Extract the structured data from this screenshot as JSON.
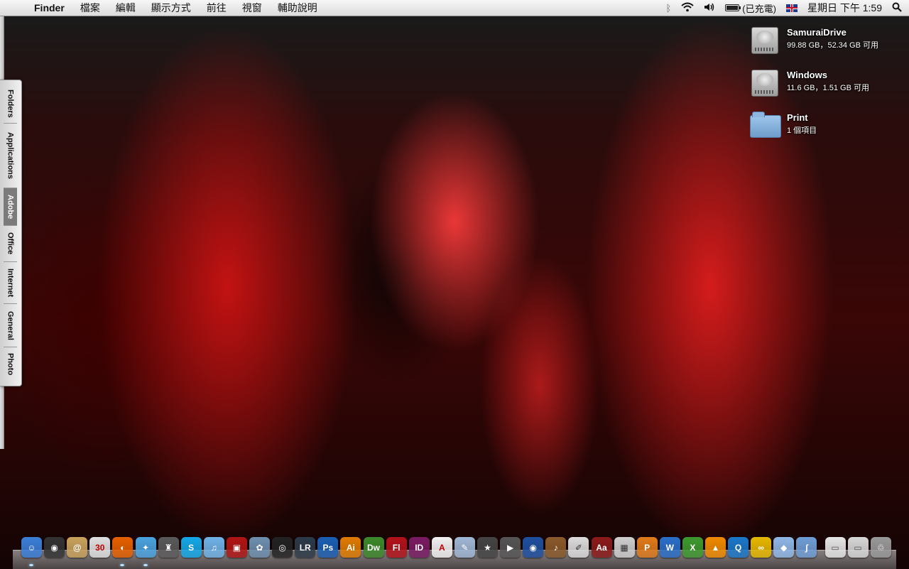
{
  "menubar": {
    "app_name": "Finder",
    "items": [
      "檔案",
      "編輯",
      "顯示方式",
      "前往",
      "視窗",
      "輔助說明"
    ],
    "battery_status": "(已充電)",
    "clock": "星期日 下午 1:59"
  },
  "drawer": {
    "tabs": [
      {
        "label": "Folders"
      },
      {
        "label": "Applications"
      },
      {
        "label": "Adobe"
      },
      {
        "label": "Office"
      },
      {
        "label": "Internet"
      },
      {
        "label": "General"
      },
      {
        "label": "Photo"
      }
    ],
    "active_tab": "Adobe"
  },
  "desktop": {
    "items": [
      {
        "name": "SamuraiDrive",
        "info": "99.88 GB，52.34 GB 可用",
        "icon": "hard-drive-icon"
      },
      {
        "name": "Windows",
        "info": "11.6 GB，1.51 GB 可用",
        "icon": "hard-drive-icon"
      },
      {
        "name": "Print",
        "info": "1 個項目",
        "icon": "folder-icon"
      }
    ]
  },
  "dock": {
    "apps": [
      {
        "name": "finder",
        "text": "☺",
        "color": "#3b7fd9"
      },
      {
        "name": "dashboard",
        "text": "◉",
        "color": "#333333"
      },
      {
        "name": "address-book",
        "text": "@",
        "color": "#c9a25c"
      },
      {
        "name": "ical",
        "text": "30",
        "color": "#e0e0e0",
        "fg": "#c00000"
      },
      {
        "name": "firefox",
        "text": "◐",
        "color": "#e66000"
      },
      {
        "name": "safari",
        "text": "✦",
        "color": "#4aa3df"
      },
      {
        "name": "script-app",
        "text": "♜",
        "color": "#5a5a5a"
      },
      {
        "name": "skype",
        "text": "S",
        "color": "#14a8e8"
      },
      {
        "name": "itunes",
        "text": "♫",
        "color": "#6fb3e8"
      },
      {
        "name": "photo-booth",
        "text": "▣",
        "color": "#b01515"
      },
      {
        "name": "iphoto",
        "text": "✿",
        "color": "#6d8fb0"
      },
      {
        "name": "aperture",
        "text": "◎",
        "color": "#222222"
      },
      {
        "name": "lightroom",
        "text": "LR",
        "color": "#2c3a4a"
      },
      {
        "name": "photoshop",
        "text": "Ps",
        "color": "#1a5fb4"
      },
      {
        "name": "illustrator",
        "text": "Ai",
        "color": "#e07b00"
      },
      {
        "name": "dreamweaver",
        "text": "Dw",
        "color": "#3c8a2a"
      },
      {
        "name": "flash",
        "text": "Fl",
        "color": "#b3121b"
      },
      {
        "name": "indesign",
        "text": "ID",
        "color": "#7a1b63"
      },
      {
        "name": "acrobat",
        "text": "A",
        "color": "#f2f2f2",
        "fg": "#c00000"
      },
      {
        "name": "preview",
        "text": "✎",
        "color": "#9fb8d6"
      },
      {
        "name": "imovie-star",
        "text": "★",
        "color": "#444444"
      },
      {
        "name": "imovie",
        "text": "▶",
        "color": "#555555"
      },
      {
        "name": "dvd-player",
        "text": "◉",
        "color": "#1e4fa0"
      },
      {
        "name": "garageband",
        "text": "♪",
        "color": "#8a5a2a"
      },
      {
        "name": "textedit",
        "text": "✐",
        "color": "#dcdcdc",
        "fg": "#333333"
      },
      {
        "name": "dictionary",
        "text": "Aa",
        "color": "#8b1a1a"
      },
      {
        "name": "calculator",
        "text": "▦",
        "color": "#cfcfcf",
        "fg": "#333333"
      },
      {
        "name": "powerpoint",
        "text": "P",
        "color": "#e07b1a"
      },
      {
        "name": "word",
        "text": "W",
        "color": "#2a6fc9"
      },
      {
        "name": "excel",
        "text": "X",
        "color": "#3d9a2e"
      },
      {
        "name": "vlc",
        "text": "▲",
        "color": "#f08a00"
      },
      {
        "name": "quicktime",
        "text": "Q",
        "color": "#1b78c9"
      },
      {
        "name": "front-row",
        "text": "∞",
        "color": "#e6b800"
      },
      {
        "name": "virtualbox",
        "text": "◆",
        "color": "#8fb8e8"
      },
      {
        "name": "fetch",
        "text": "∫",
        "color": "#6f9fd6"
      },
      {
        "name": "documents-stack",
        "text": "▭",
        "color": "#e6e6e6",
        "fg": "#555555"
      },
      {
        "name": "downloads-stack",
        "text": "▭",
        "color": "#d8d8d8",
        "fg": "#555555"
      },
      {
        "name": "trash",
        "text": "♲",
        "color": "#9a9a9a"
      }
    ]
  }
}
